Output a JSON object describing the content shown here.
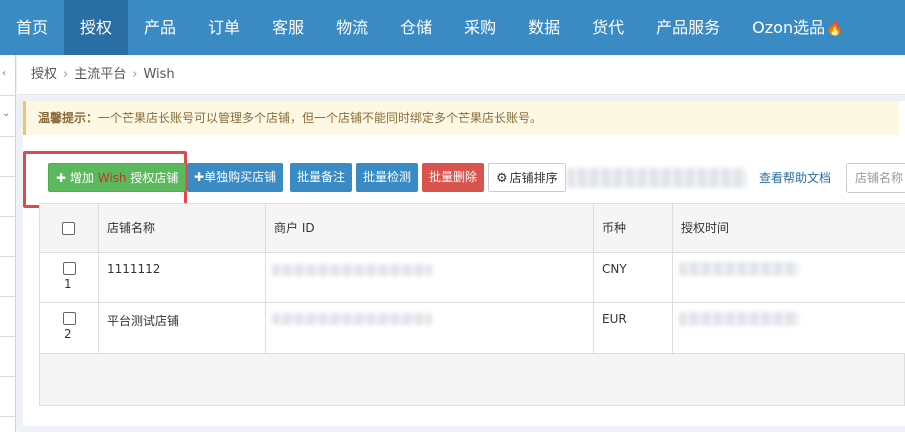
{
  "nav": {
    "items": [
      "首页",
      "授权",
      "产品",
      "订单",
      "客服",
      "物流",
      "仓储",
      "采购",
      "数据",
      "货代",
      "产品服务",
      "Ozon选品"
    ],
    "active_index": 1,
    "fire_icon": "flame-icon"
  },
  "breadcrumb": [
    "授权",
    "主流平台",
    "Wish"
  ],
  "tip": {
    "label": "温馨提示：",
    "text": "一个芒果店长账号可以管理多个店铺，但一个店铺不能同时绑定多个芒果店长账号。"
  },
  "toolbar": {
    "add_prefix": "增加",
    "add_platform": "Wish",
    "add_suffix": "授权店铺",
    "buy": "单独购买店铺",
    "batch_note": "批量备注",
    "batch_check": "批量检测",
    "batch_delete": "批量删除",
    "sort": "店铺排序",
    "help": "查看帮助文档",
    "search_placeholder": "店铺名称"
  },
  "table": {
    "headers": [
      "店铺名称",
      "商户 ID",
      "币种",
      "授权时间"
    ],
    "rows": [
      {
        "num": "1",
        "name": "1111112",
        "currency": "CNY"
      },
      {
        "num": "2",
        "name": "平台测试店铺",
        "currency": "EUR"
      }
    ]
  },
  "colors": {
    "nav_bg": "#3a8ac4",
    "nav_active": "#2a6fa3",
    "green": "#5cb85c",
    "red": "#d9534f",
    "highlight": "#e04a4a"
  }
}
